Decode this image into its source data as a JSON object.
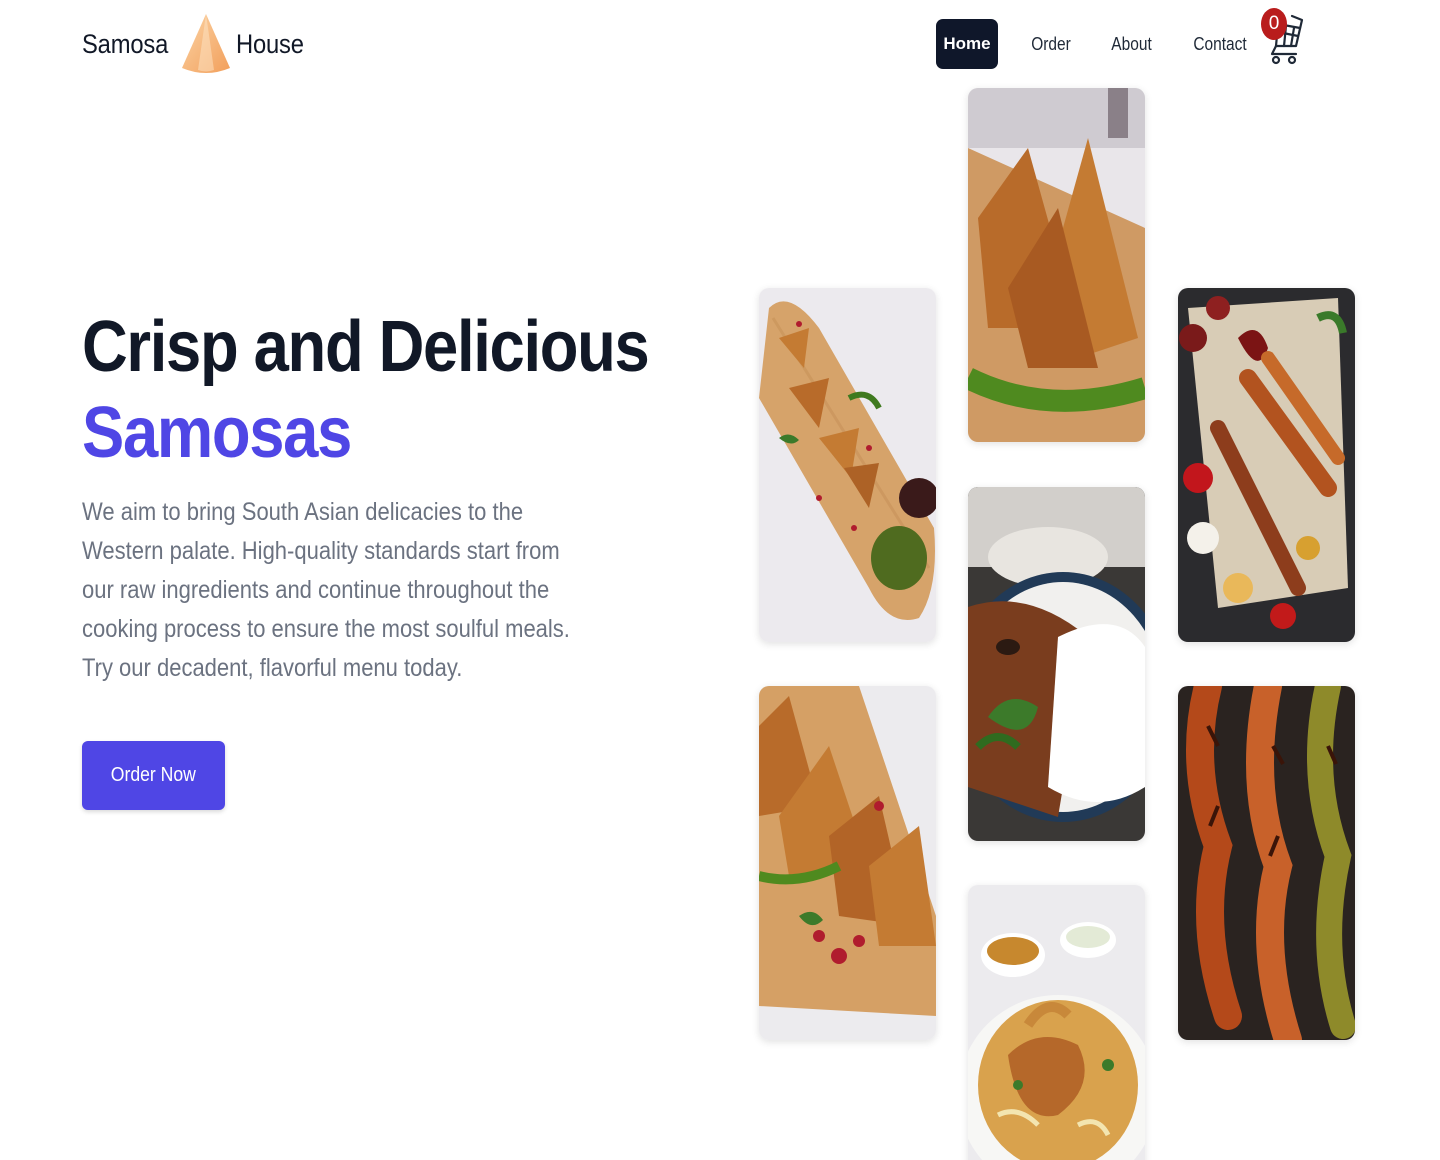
{
  "brand": {
    "word_left": "Samosa",
    "word_right": "House",
    "logo_icon": "samosa-triangle-icon"
  },
  "nav": {
    "items": [
      {
        "label": "Home",
        "active": true
      },
      {
        "label": "Order",
        "active": false
      },
      {
        "label": "About",
        "active": false
      },
      {
        "label": "Contact",
        "active": false
      }
    ],
    "cart": {
      "icon": "shopping-cart-icon",
      "count": "0"
    }
  },
  "hero": {
    "title_line1": "Crisp and Delicious",
    "title_line2": "Samosas",
    "description": "We aim to bring South Asian delicacies to the Western palate. High-quality standards start from our raw ingredients and continue throughout the cooking process to ensure the most soulful meals. Try our decadent, flavorful menu today.",
    "cta_label": "Order Now"
  },
  "gallery": {
    "images": [
      "samosas-on-wooden-board-with-chutney",
      "samosas-with-green-chili-closeup",
      "grilled-kebab-platter-with-sauces",
      "samosas-on-bamboo-tray-with-pomegranate",
      "curry-and-rice-bowl",
      "tandoori-chicken-skewers",
      "biryani-plate-with-dips"
    ]
  },
  "colors": {
    "accent": "#4f46e5",
    "dark": "#111827",
    "nav_active_bg": "#0f172a",
    "badge": "#b91c1c",
    "text_muted": "#6b7280",
    "logo_orange": "#f6b57e"
  }
}
